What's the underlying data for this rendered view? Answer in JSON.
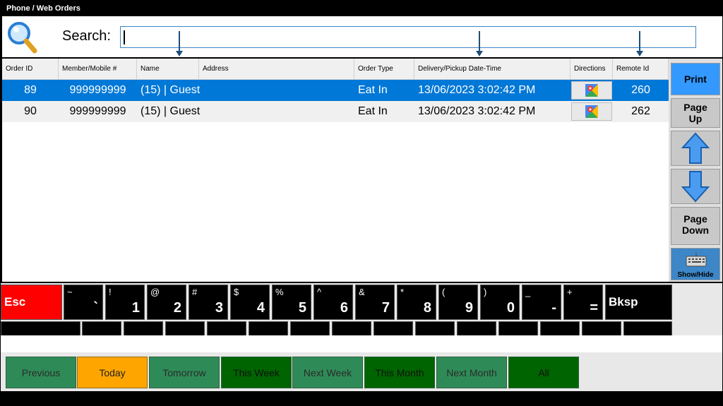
{
  "window": {
    "title": "Phone / Web Orders"
  },
  "search": {
    "label": "Search:",
    "value": ""
  },
  "table": {
    "columns": [
      "Order ID",
      "Member/Mobile #",
      "Name",
      "Address",
      "Order Type",
      "Delivery/Pickup Date-Time",
      "Directions",
      "Remote Id"
    ],
    "rows": [
      {
        "order_id": "89",
        "member": "999999999",
        "name": "(15) | Guest",
        "address": "",
        "order_type": "Eat In",
        "datetime": "13/06/2023 3:02:42 PM",
        "directions": "map-icon",
        "remote_id": "260",
        "selected": true
      },
      {
        "order_id": "90",
        "member": "999999999",
        "name": "(15) | Guest",
        "address": "",
        "order_type": "Eat In",
        "datetime": "13/06/2023 3:02:42 PM",
        "directions": "map-icon",
        "remote_id": "262",
        "selected": false
      }
    ]
  },
  "side": {
    "print": "Print",
    "page_up_1": "Page",
    "page_up_2": "Up",
    "page_down_1": "Page",
    "page_down_2": "Down",
    "show_hide": "Show/Hide"
  },
  "keyboard": {
    "esc": "Esc",
    "bksp": "Bksp",
    "keys": [
      {
        "top": "~",
        "bot": "`"
      },
      {
        "top": "!",
        "bot": "1"
      },
      {
        "top": "@",
        "bot": "2"
      },
      {
        "top": "#",
        "bot": "3"
      },
      {
        "top": "$",
        "bot": "4"
      },
      {
        "top": "%",
        "bot": "5"
      },
      {
        "top": "^",
        "bot": "6"
      },
      {
        "top": "&",
        "bot": "7"
      },
      {
        "top": "*",
        "bot": "8"
      },
      {
        "top": "(",
        "bot": "9"
      },
      {
        "top": ")",
        "bot": "0"
      },
      {
        "top": "_",
        "bot": "-"
      },
      {
        "top": "+",
        "bot": "="
      }
    ]
  },
  "filters": [
    {
      "label": "Previous",
      "style": "light"
    },
    {
      "label": "Today",
      "style": "today"
    },
    {
      "label": "Tomorrow",
      "style": "light"
    },
    {
      "label": "This Week",
      "style": "dark"
    },
    {
      "label": "Next Week",
      "style": "light"
    },
    {
      "label": "This Month",
      "style": "dark"
    },
    {
      "label": "Next Month",
      "style": "light"
    },
    {
      "label": "All",
      "style": "dark"
    }
  ],
  "colors": {
    "selected_row": "#0078d7",
    "print_button": "#3399ff",
    "today_button": "#ffa500",
    "esc_key": "#ff0000"
  }
}
